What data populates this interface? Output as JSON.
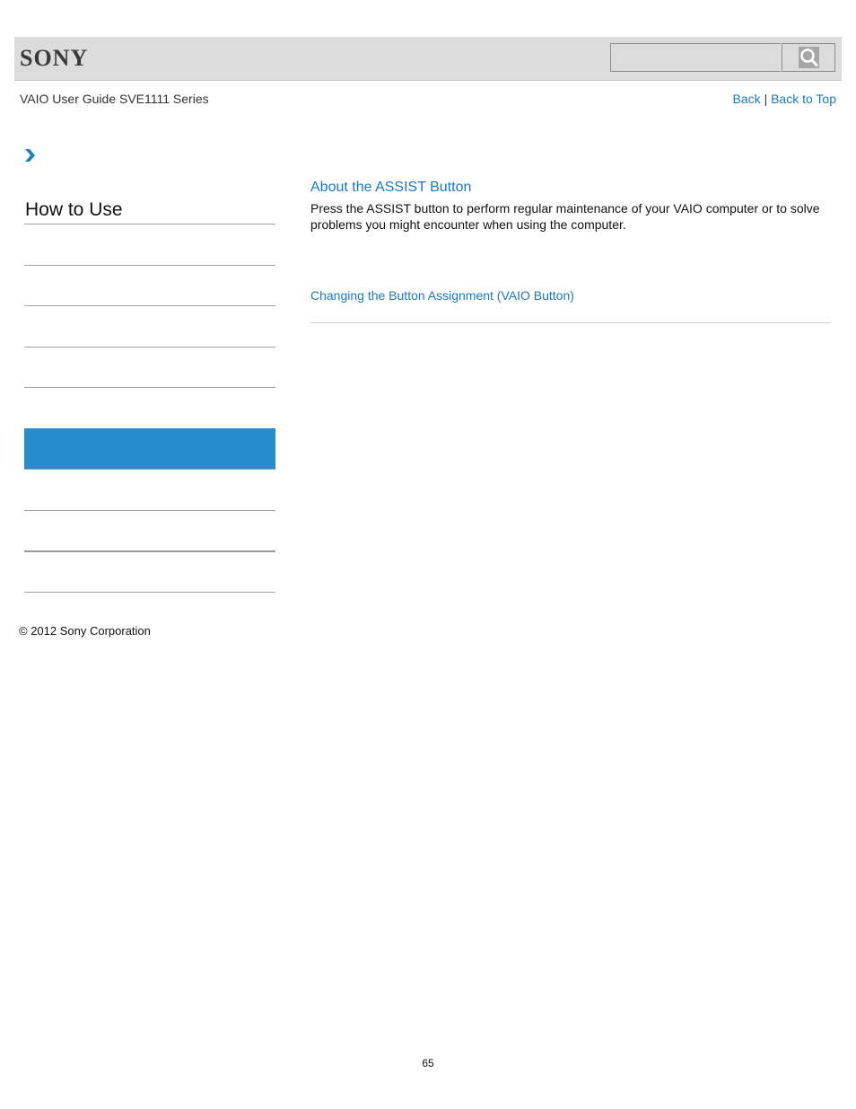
{
  "header": {
    "logo_text": "SONY",
    "search": {
      "placeholder": "",
      "value": "",
      "button_icon": "search-icon"
    }
  },
  "subheader": {
    "guide_title": "VAIO User Guide SVE1111 Series",
    "back_label": "Back",
    "separator": "|",
    "back_to_top_label": "Back to Top"
  },
  "sidebar": {
    "breadcrumb_icon": "chevron-right-icon",
    "section_title": "How to Use",
    "active_item_index": 5,
    "items": [
      "",
      "",
      "",
      "",
      "",
      "",
      "",
      "",
      ""
    ]
  },
  "content": {
    "heading": "About the ASSIST Button",
    "body": "Press the ASSIST button to perform regular maintenance of your VAIO computer or to solve problems you might encounter when using the computer.",
    "related_links": [
      "Changing the Button Assignment (VAIO Button)"
    ]
  },
  "footer": {
    "copyright": "© 2012 Sony Corporation",
    "page_number": "65"
  },
  "colors": {
    "link": "#1a78c2",
    "active_sidebar": "#268ccb",
    "header_bg": "#dcdcdc"
  }
}
